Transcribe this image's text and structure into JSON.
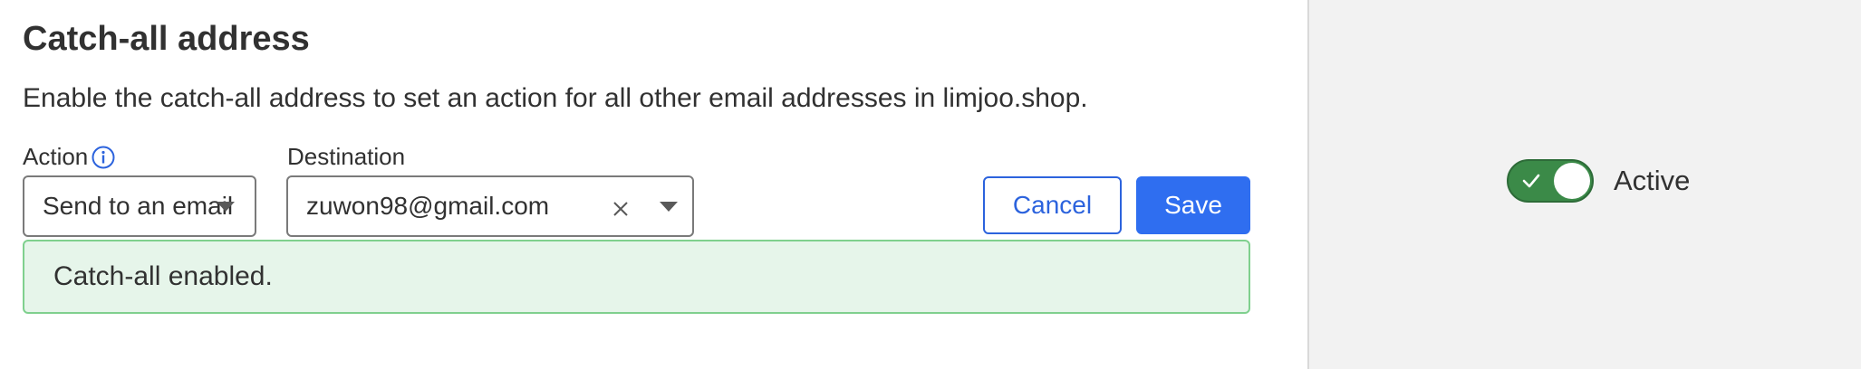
{
  "section": {
    "title": "Catch-all address",
    "description": "Enable the catch-all address to set an action for all other email addresses in limjoo.shop."
  },
  "form": {
    "action_label": "Action",
    "action_value": "Send to an email",
    "destination_label": "Destination",
    "destination_value": "zuwon98@gmail.com"
  },
  "buttons": {
    "cancel": "Cancel",
    "save": "Save"
  },
  "notice": {
    "text": "Catch-all enabled."
  },
  "status": {
    "label": "Active",
    "enabled": true
  },
  "icons": {
    "info": "info-icon",
    "clear": "close-icon",
    "dropdown": "chevron-down-icon",
    "check": "check-icon"
  },
  "colors": {
    "accent": "#2f6ef0",
    "success_bg": "#e6f5ea",
    "success_border": "#7fd08e",
    "toggle_on": "#3b8a48"
  }
}
